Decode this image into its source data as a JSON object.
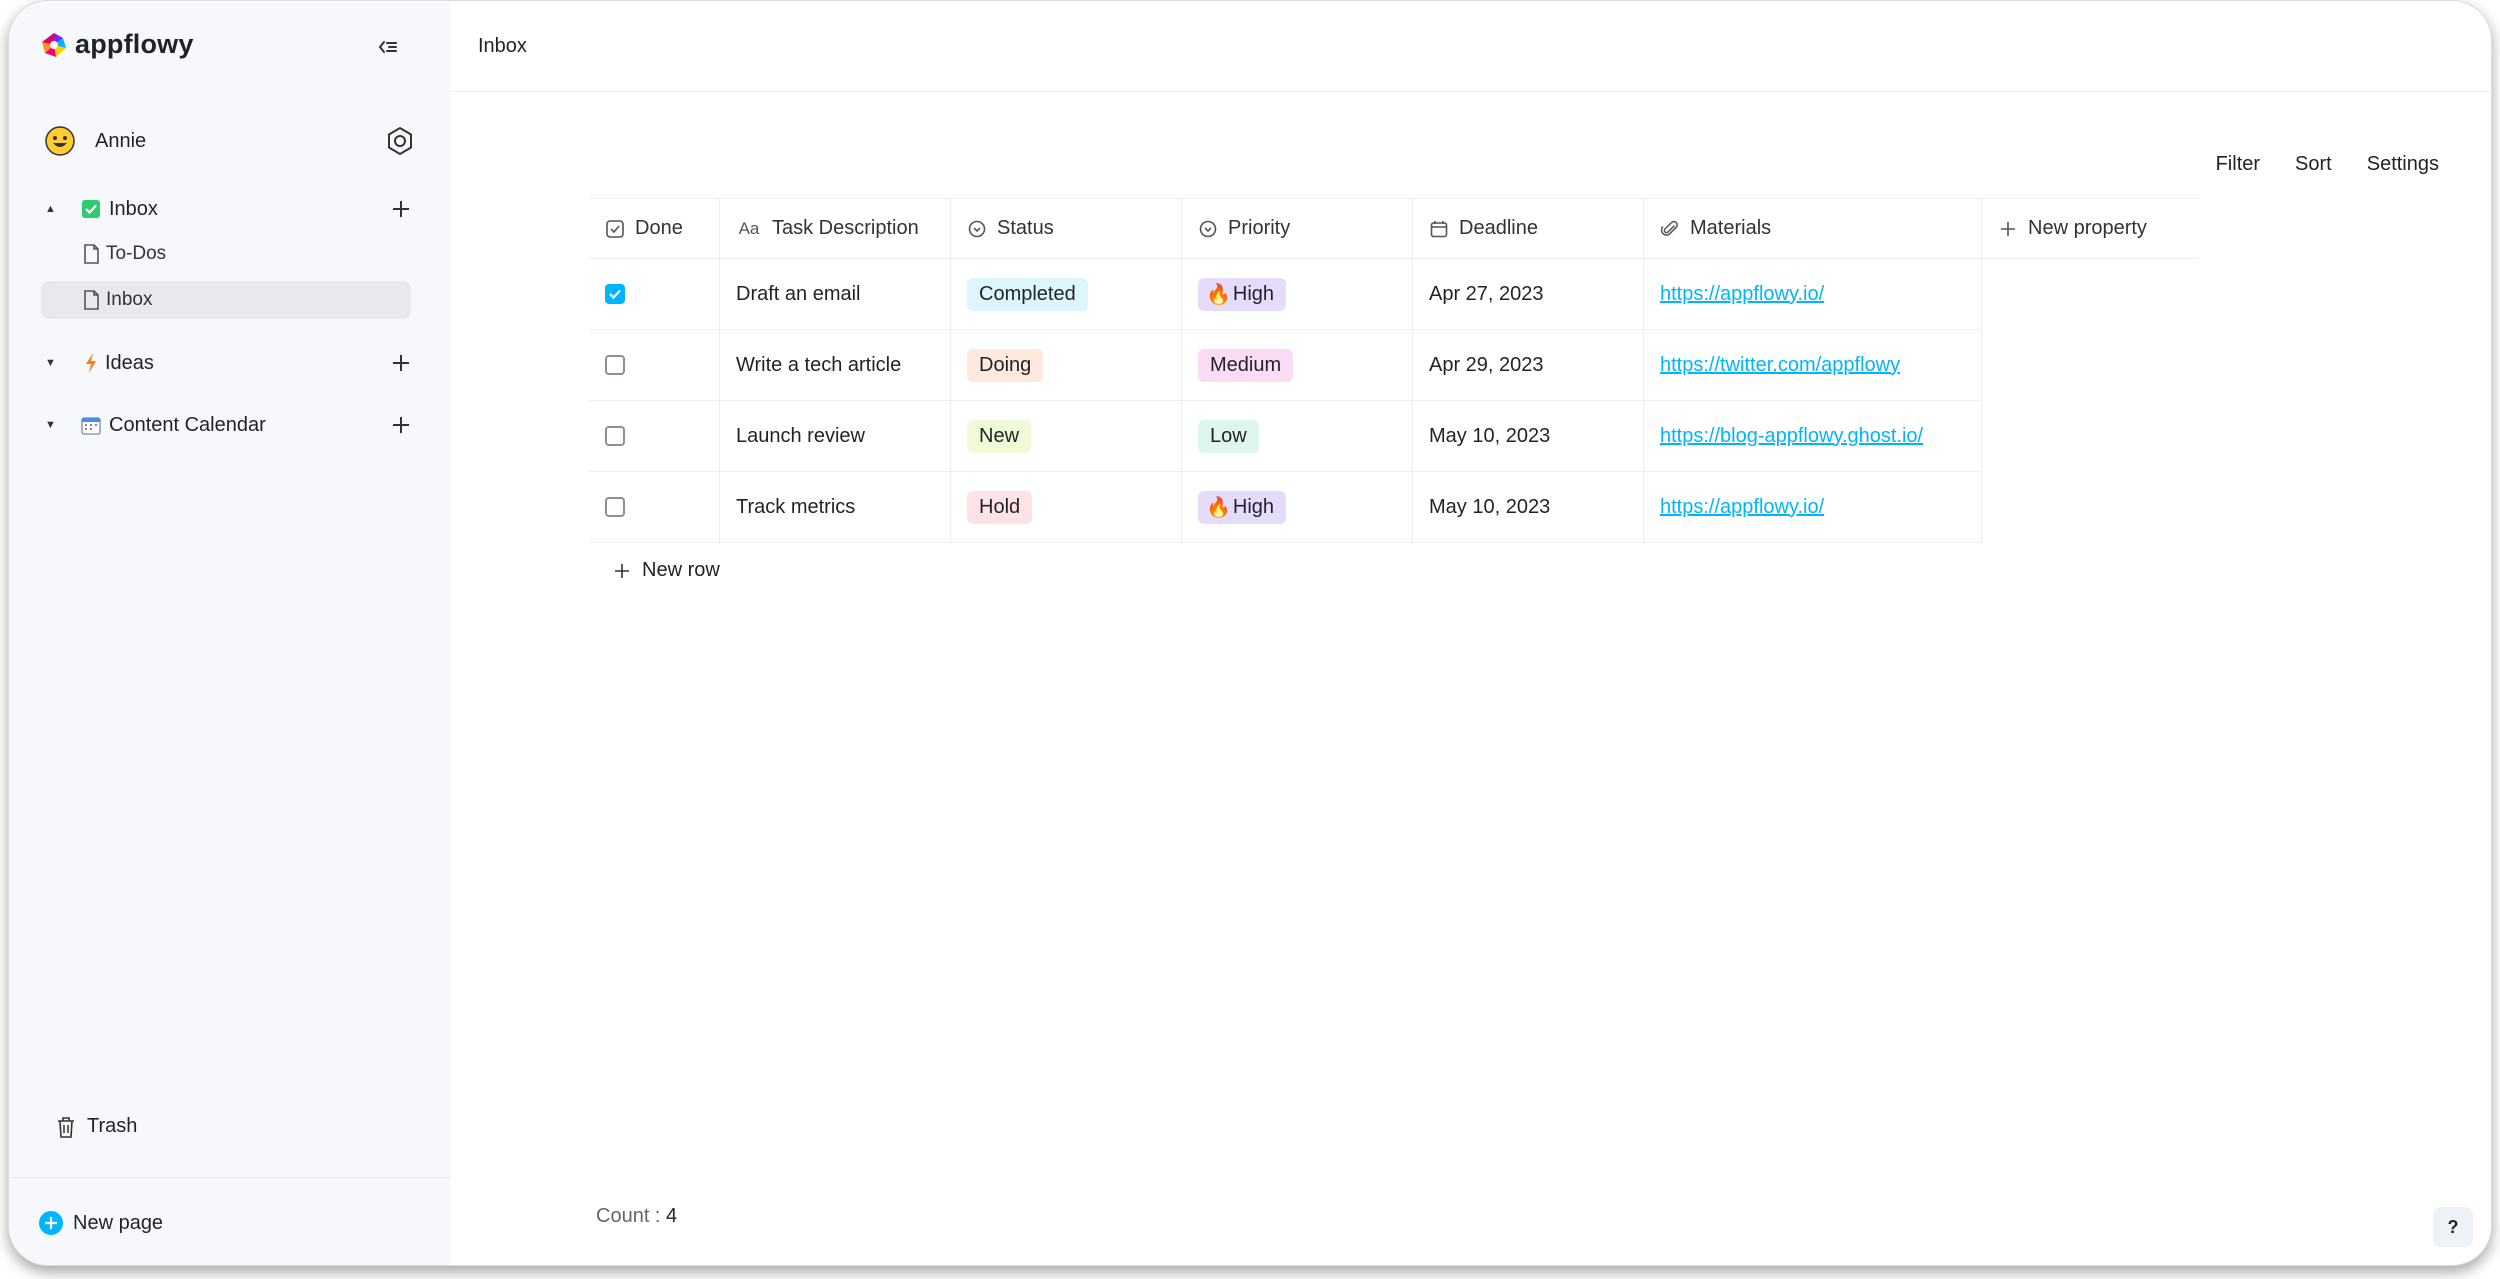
{
  "app": {
    "name": "appflowy"
  },
  "sidebar": {
    "user": {
      "name": "Annie"
    },
    "sections": [
      {
        "label": "Inbox",
        "icon": "check-box-icon",
        "expanded": true
      },
      {
        "label": "Ideas",
        "icon": "lightning-icon",
        "expanded": true
      },
      {
        "label": "Content Calendar",
        "icon": "calendar-icon",
        "expanded": true
      }
    ],
    "subitems": [
      {
        "label": "To-Dos",
        "active": false
      },
      {
        "label": "Inbox",
        "active": true
      }
    ],
    "trash_label": "Trash",
    "new_page_label": "New page"
  },
  "topbar": {
    "breadcrumb": "Inbox"
  },
  "toolbar": {
    "filter": "Filter",
    "sort": "Sort",
    "settings": "Settings"
  },
  "grid": {
    "columns": [
      {
        "label": "Done",
        "icon": "checkbox-icon"
      },
      {
        "label": "Task Description",
        "icon": "text-icon",
        "icon_text": "Aa"
      },
      {
        "label": "Status",
        "icon": "single-select-icon"
      },
      {
        "label": "Priority",
        "icon": "single-select-icon"
      },
      {
        "label": "Deadline",
        "icon": "calendar-icon"
      },
      {
        "label": "Materials",
        "icon": "paperclip-icon"
      },
      {
        "label": "New property",
        "icon": "plus-icon"
      }
    ],
    "rows": [
      {
        "done": true,
        "task": "Draft an email",
        "status": "Completed",
        "priority": "High",
        "deadline": "Apr 27, 2023",
        "materials": "https://appflowy.io/"
      },
      {
        "done": false,
        "task": "Write a tech article",
        "status": "Doing",
        "priority": "Medium",
        "deadline": "Apr 29, 2023",
        "materials": "https://twitter.com/appflowy"
      },
      {
        "done": false,
        "task": "Launch review",
        "status": "New",
        "priority": "Low",
        "deadline": "May 10, 2023",
        "materials": "https://blog-appflowy.ghost.io/"
      },
      {
        "done": false,
        "task": "Track metrics",
        "status": "Hold",
        "priority": "High",
        "deadline": "May 10, 2023",
        "materials": "https://appflowy.io/"
      }
    ],
    "new_row_label": "New row",
    "count_label": "Count : ",
    "count_value": "4"
  },
  "colors": {
    "accent": "#00b5ff",
    "status": {
      "Completed": "#ddf6fb",
      "Doing": "#fde9de",
      "New": "#f0f9d8",
      "Hold": "#fde2e6"
    },
    "priority": {
      "High": "#e5dcfb",
      "Medium": "#fbdcf4",
      "Low": "#dff6ef"
    }
  },
  "help_label": "?"
}
